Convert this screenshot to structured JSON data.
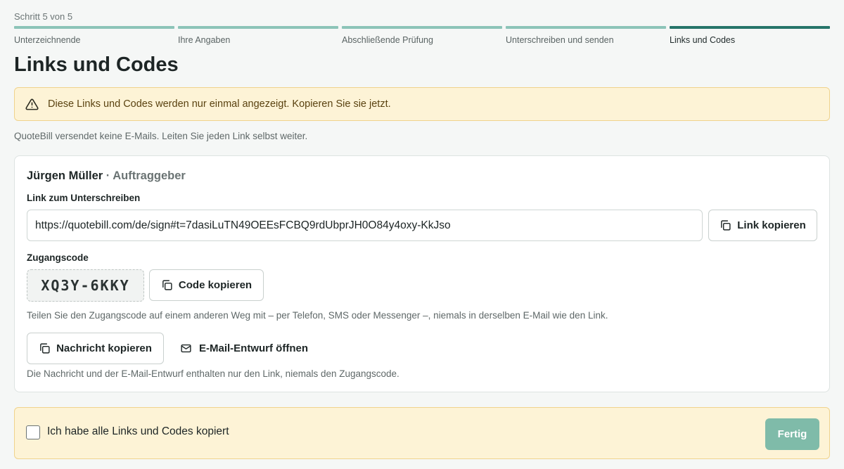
{
  "progress": {
    "label": "Schritt 5 von 5",
    "steps": [
      {
        "label": "Unterzeichnende"
      },
      {
        "label": "Ihre Angaben"
      },
      {
        "label": "Abschließende Prüfung"
      },
      {
        "label": "Unterschreiben und senden"
      },
      {
        "label": "Links und Codes"
      }
    ],
    "active_step": 5
  },
  "page": {
    "title": "Links und Codes",
    "warning": "Diese Links und Codes werden nur einmal angezeigt. Kopieren Sie sie jetzt.",
    "note": "QuoteBill versendet keine E-Mails. Leiten Sie jeden Link selbst weiter."
  },
  "signer": {
    "name": "Jürgen Müller",
    "separator": "·",
    "role": "Auftraggeber",
    "link_label": "Link zum Unterschreiben",
    "link_value": "https://quotebill.com/de/sign#t=7dasiLuTN49OEEsFCBQ9rdUbprJH0O84y4oxy-KkJso",
    "copy_link_label": "Link kopieren",
    "code_label": "Zugangscode",
    "code_value": "XQ3Y-6KKY",
    "copy_code_label": "Code kopieren",
    "code_hint": "Teilen Sie den Zugangscode auf einem anderen Weg mit – per Telefon, SMS oder Messenger –, niemals in derselben E-Mail wie den Link.",
    "copy_message_label": "Nachricht kopieren",
    "email_draft_label": "E-Mail-Entwurf öffnen",
    "message_hint": "Die Nachricht und der E-Mail-Entwurf enthalten nur den Link, niemals den Zugangscode."
  },
  "confirm": {
    "checkbox_label": "Ich habe alle Links und Codes kopiert",
    "checked": false,
    "done_label": "Fertig"
  },
  "colors": {
    "accent": "#26756a",
    "step_inactive": "#8cc4b8",
    "warning_bg": "#fdf3d6",
    "done_button": "#7fbba9"
  },
  "icons": {
    "warning": "warning-triangle-icon",
    "copy": "copy-icon",
    "mail": "mail-icon"
  }
}
